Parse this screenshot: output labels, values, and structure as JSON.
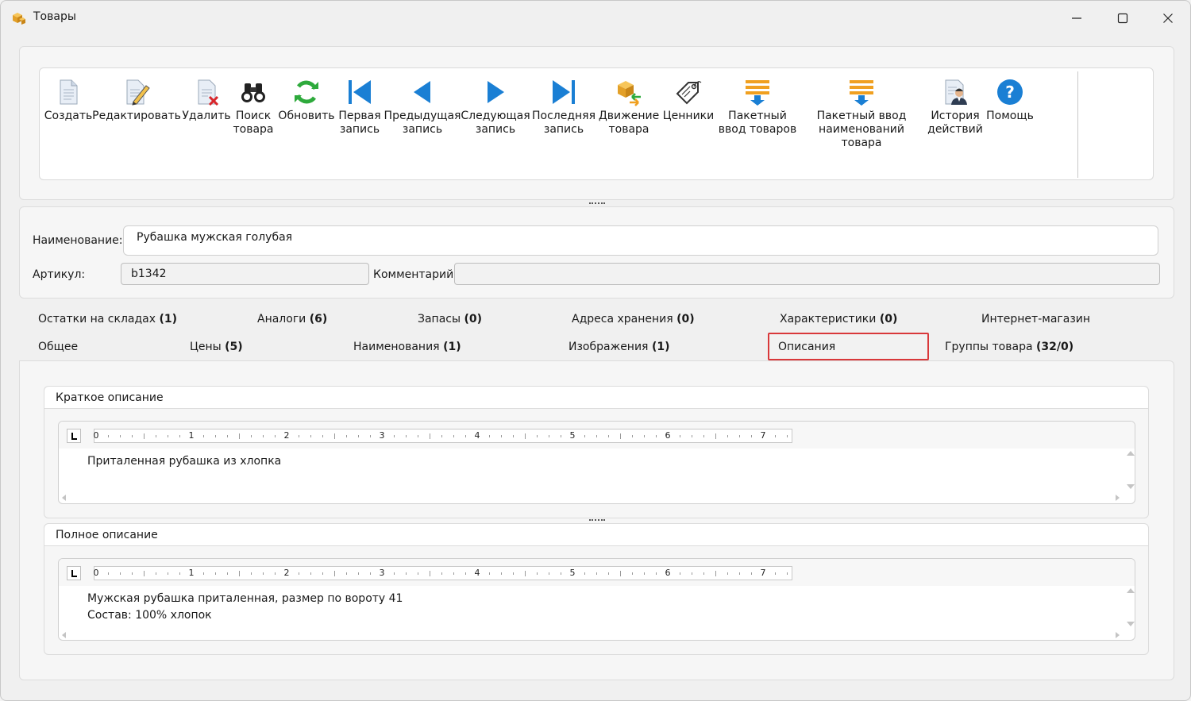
{
  "window": {
    "title": "Товары"
  },
  "toolbar": {
    "buttons": [
      {
        "label": "Создать",
        "icon": "new-document-icon"
      },
      {
        "label": "Редактировать",
        "icon": "edit-document-icon"
      },
      {
        "label": "Удалить",
        "icon": "delete-document-icon"
      },
      {
        "label": "Поиск\nтовара",
        "icon": "binoculars-icon"
      },
      {
        "label": "Обновить",
        "icon": "refresh-icon"
      },
      {
        "label": "Первая\nзапись",
        "icon": "first-record-icon"
      },
      {
        "label": "Предыдущая\nзапись",
        "icon": "previous-record-icon"
      },
      {
        "label": "Следующая\nзапись",
        "icon": "next-record-icon"
      },
      {
        "label": "Последняя\nзапись",
        "icon": "last-record-icon"
      },
      {
        "label": "Движение\nтовара",
        "icon": "boxes-movement-icon"
      },
      {
        "label": "Ценники",
        "icon": "price-tag-icon"
      },
      {
        "label": "Пакетный\nввод товаров",
        "icon": "batch-import-icon"
      },
      {
        "label": "Пакетный ввод\nнаименований товара",
        "icon": "batch-names-import-icon"
      },
      {
        "label": "История\nдействий",
        "icon": "history-user-icon"
      },
      {
        "label": "Помощь",
        "icon": "help-icon"
      }
    ]
  },
  "form": {
    "name_label": "Наименование:",
    "name_value": "Рубашка мужская голубая",
    "article_label": "Артикул:",
    "article_value": "b1342",
    "comment_label": "Комментарий:",
    "comment_value": ""
  },
  "tabs": {
    "row1": [
      {
        "label": "Остатки на складах ",
        "count": "(1)"
      },
      {
        "label": "Аналоги ",
        "count": "(6)"
      },
      {
        "label": "Запасы ",
        "count": "(0)"
      },
      {
        "label": "Адреса хранения ",
        "count": "(0)"
      },
      {
        "label": "Характеристики ",
        "count": "(0)"
      },
      {
        "label": "Интернет-магазин",
        "count": ""
      }
    ],
    "row2": [
      {
        "label": "Общее",
        "count": ""
      },
      {
        "label": "Цены ",
        "count": "(5)"
      },
      {
        "label": "Наименования ",
        "count": "(1)"
      },
      {
        "label": "Изображения ",
        "count": "(1)"
      },
      {
        "label": "Описания",
        "count": "",
        "active": true
      },
      {
        "label": "Группы товара ",
        "count": "(32/0)"
      }
    ]
  },
  "descriptions": {
    "short": {
      "title": "Краткое описание",
      "text": "Приталенная рубашка из хлопка"
    },
    "full": {
      "title": "Полное описание",
      "text": "Мужская рубашка приталенная, размер по вороту 41\nСостав: 100% хлопок"
    }
  },
  "ruler_numbers": [
    "0",
    "1",
    "2",
    "3",
    "4",
    "5",
    "6",
    "7"
  ],
  "colors": {
    "accent_blue": "#1a7fd4",
    "active_tab_border": "#d9383a",
    "refresh_green": "#2eaa3c",
    "batch_orange": "#f0a020"
  }
}
